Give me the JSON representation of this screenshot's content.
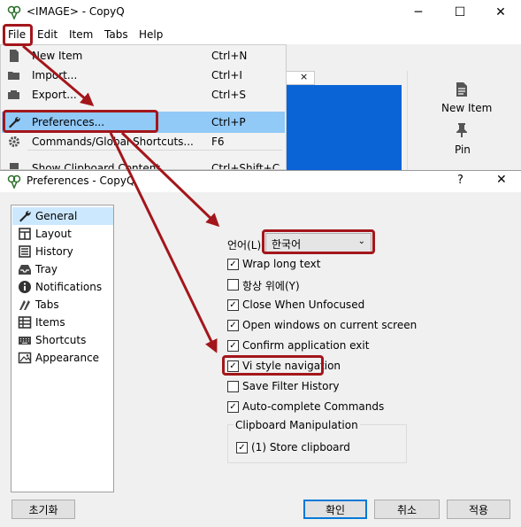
{
  "main_window": {
    "title": "<IMAGE> - CopyQ",
    "menu": [
      "File",
      "Edit",
      "Item",
      "Tabs",
      "Help"
    ],
    "toolbar": [
      "New Item",
      "Pin"
    ]
  },
  "file_menu": {
    "items": [
      {
        "label": "New Item",
        "shortcut": "Ctrl+N",
        "icon": "new-item-icon"
      },
      {
        "label": "Import...",
        "shortcut": "Ctrl+I",
        "icon": "import-icon"
      },
      {
        "label": "Export...",
        "shortcut": "Ctrl+S",
        "icon": "export-icon"
      },
      {
        "label": "Preferences...",
        "shortcut": "Ctrl+P",
        "icon": "wrench-icon"
      },
      {
        "label": "Commands/Global Shortcuts...",
        "shortcut": "F6",
        "icon": "gear-icon"
      },
      {
        "label": "Show Clipboard Content",
        "shortcut": "Ctrl+Shift+C",
        "icon": "clipboard-icon"
      }
    ],
    "selected": "Preferences..."
  },
  "preferences": {
    "title": "Preferences - CopyQ",
    "help": "?",
    "categories": [
      "General",
      "Layout",
      "History",
      "Tray",
      "Notifications",
      "Tabs",
      "Items",
      "Shortcuts",
      "Appearance"
    ],
    "selected_category": "General",
    "language_label": "언어(L):",
    "language_value": "한국어",
    "options": [
      {
        "label": "Wrap long text",
        "checked": true
      },
      {
        "label": "항상 위에(Y)",
        "checked": false
      },
      {
        "label": "Close When Unfocused",
        "checked": true
      },
      {
        "label": "Open windows on current screen",
        "checked": true
      },
      {
        "label": "Confirm application exit",
        "checked": true
      },
      {
        "label": "Vi style navigation",
        "checked": true
      },
      {
        "label": "Save Filter History",
        "checked": false
      },
      {
        "label": "Auto-complete Commands",
        "checked": true
      }
    ],
    "clipboard_group": {
      "title": "Clipboard Manipulation",
      "option": {
        "label": "(1) Store clipboard",
        "checked": true
      }
    },
    "buttons": {
      "reset": "초기화",
      "ok": "확인",
      "cancel": "취소",
      "apply": "적용"
    }
  },
  "colors": {
    "highlight": "#a3161b",
    "selection": "#91c9f7",
    "list_blue": "#0a64d6"
  }
}
